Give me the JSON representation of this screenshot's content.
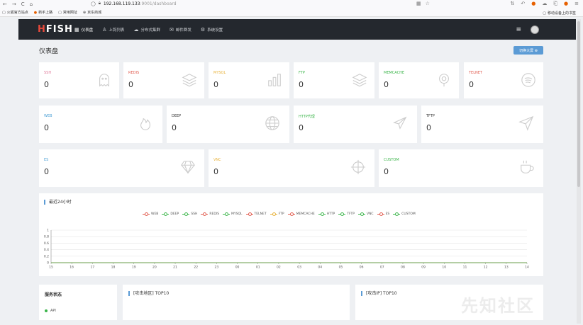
{
  "browser": {
    "host": "192.168.119.133",
    "path": ":9001/dashboard",
    "bookmarks": [
      "火狐官方站点",
      "新手上路",
      "常用网址",
      "京东商城"
    ],
    "mobile_bookmarks": "移动设备上的书签"
  },
  "app": {
    "logo_h": "H",
    "logo_rest": "FISH",
    "menu": [
      {
        "label": "仪表盘",
        "icon": "dashboard-icon",
        "active": true
      },
      {
        "label": "上钩列表",
        "icon": "user-icon",
        "active": false
      },
      {
        "label": "分布式集群",
        "icon": "cloud-icon",
        "active": false
      },
      {
        "label": "邮件群发",
        "icon": "mail-icon",
        "active": false
      },
      {
        "label": "系统设置",
        "icon": "gear-icon",
        "active": false
      }
    ]
  },
  "page": {
    "title": "仪表盘",
    "switch_button": "切换大屏 ⊕"
  },
  "cards": [
    {
      "label": "SSH",
      "value": "0",
      "color": "#e07a9a",
      "icon": "ghost-icon"
    },
    {
      "label": "REDIS",
      "value": "0",
      "color": "#e05a4d",
      "icon": "layers-icon"
    },
    {
      "label": "MYSQL",
      "value": "0",
      "color": "#e8b23a",
      "icon": "bar-chart-icon"
    },
    {
      "label": "FTP",
      "value": "0",
      "color": "#3bb54a",
      "icon": "layers-icon"
    },
    {
      "label": "MEMCACHE",
      "value": "0",
      "color": "#3bb54a",
      "icon": "pin-icon"
    },
    {
      "label": "TELNET",
      "value": "0",
      "color": "#e05a4d",
      "icon": "spotify-icon"
    },
    {
      "label": "WEB",
      "value": "0",
      "color": "#4a9fd5",
      "icon": "fire-icon"
    },
    {
      "label": "DEEP",
      "value": "0",
      "color": "#333333",
      "icon": "globe-icon"
    },
    {
      "label": "HTTP代理",
      "value": "0",
      "color": "#3bb54a",
      "icon": "plane-icon"
    },
    {
      "label": "TFTP",
      "value": "0",
      "color": "#333333",
      "icon": "send-icon"
    },
    {
      "label": "ES",
      "value": "0",
      "color": "#4a9fd5",
      "icon": "diamond-icon"
    },
    {
      "label": "VNC",
      "value": "0",
      "color": "#e8b23a",
      "icon": "crosshair-icon"
    },
    {
      "label": "CUSTOM",
      "value": "0",
      "color": "#3bb54a",
      "icon": "cup-icon"
    }
  ],
  "chart_data": {
    "type": "line",
    "title": "最近24小时",
    "categories": [
      "15",
      "16",
      "17",
      "18",
      "19",
      "20",
      "21",
      "22",
      "23",
      "00",
      "01",
      "02",
      "03",
      "04",
      "05",
      "06",
      "07",
      "08",
      "09",
      "10",
      "11",
      "12",
      "13",
      "14"
    ],
    "series": [
      {
        "name": "WEB",
        "color": "#e05a4d",
        "values": [
          0,
          0,
          0,
          0,
          0,
          0,
          0,
          0,
          0,
          0,
          0,
          0,
          0,
          0,
          0,
          0,
          0,
          0,
          0,
          0,
          0,
          0,
          0,
          0
        ]
      },
      {
        "name": "DEEP",
        "color": "#3bb54a",
        "values": [
          0,
          0,
          0,
          0,
          0,
          0,
          0,
          0,
          0,
          0,
          0,
          0,
          0,
          0,
          0,
          0,
          0,
          0,
          0,
          0,
          0,
          0,
          0,
          0
        ]
      },
      {
        "name": "SSH",
        "color": "#3bb54a",
        "values": [
          0,
          0,
          0,
          0,
          0,
          0,
          0,
          0,
          0,
          0,
          0,
          0,
          0,
          0,
          0,
          0,
          0,
          0,
          0,
          0,
          0,
          0,
          0,
          0
        ]
      },
      {
        "name": "REDIS",
        "color": "#e05a4d",
        "values": [
          0,
          0,
          0,
          0,
          0,
          0,
          0,
          0,
          0,
          0,
          0,
          0,
          0,
          0,
          0,
          0,
          0,
          0,
          0,
          0,
          0,
          0,
          0,
          0
        ]
      },
      {
        "name": "MYSQL",
        "color": "#3bb54a",
        "values": [
          0,
          0,
          0,
          0,
          0,
          0,
          0,
          0,
          0,
          0,
          0,
          0,
          0,
          0,
          0,
          0,
          0,
          0,
          0,
          0,
          0,
          0,
          0,
          0
        ]
      },
      {
        "name": "TELNET",
        "color": "#e05a4d",
        "values": [
          0,
          0,
          0,
          0,
          0,
          0,
          0,
          0,
          0,
          0,
          0,
          0,
          0,
          0,
          0,
          0,
          0,
          0,
          0,
          0,
          0,
          0,
          0,
          0
        ]
      },
      {
        "name": "FTP",
        "color": "#e8b23a",
        "values": [
          0,
          0,
          0,
          0,
          0,
          0,
          0,
          0,
          0,
          0,
          0,
          0,
          0,
          0,
          0,
          0,
          0,
          0,
          0,
          0,
          0,
          0,
          0,
          0
        ]
      },
      {
        "name": "MEMCACHE",
        "color": "#e05a4d",
        "values": [
          0,
          0,
          0,
          0,
          0,
          0,
          0,
          0,
          0,
          0,
          0,
          0,
          0,
          0,
          0,
          0,
          0,
          0,
          0,
          0,
          0,
          0,
          0,
          0
        ]
      },
      {
        "name": "HTTP",
        "color": "#3bb54a",
        "values": [
          0,
          0,
          0,
          0,
          0,
          0,
          0,
          0,
          0,
          0,
          0,
          0,
          0,
          0,
          0,
          0,
          0,
          0,
          0,
          0,
          0,
          0,
          0,
          0
        ]
      },
      {
        "name": "TFTP",
        "color": "#3bb54a",
        "values": [
          0,
          0,
          0,
          0,
          0,
          0,
          0,
          0,
          0,
          0,
          0,
          0,
          0,
          0,
          0,
          0,
          0,
          0,
          0,
          0,
          0,
          0,
          0,
          0
        ]
      },
      {
        "name": "VNC",
        "color": "#3bb54a",
        "values": [
          0,
          0,
          0,
          0,
          0,
          0,
          0,
          0,
          0,
          0,
          0,
          0,
          0,
          0,
          0,
          0,
          0,
          0,
          0,
          0,
          0,
          0,
          0,
          0
        ]
      },
      {
        "name": "ES",
        "color": "#e05a4d",
        "values": [
          0,
          0,
          0,
          0,
          0,
          0,
          0,
          0,
          0,
          0,
          0,
          0,
          0,
          0,
          0,
          0,
          0,
          0,
          0,
          0,
          0,
          0,
          0,
          0
        ]
      },
      {
        "name": "CUSTOM",
        "color": "#3bb54a",
        "values": [
          0,
          0,
          0,
          0,
          0,
          0,
          0,
          0,
          0,
          0,
          0,
          0,
          0,
          0,
          0,
          0,
          0,
          0,
          0,
          0,
          0,
          0,
          0,
          0
        ]
      }
    ],
    "y_ticks": [
      "0",
      "0.2",
      "0.4",
      "0.6",
      "0.8",
      "1"
    ],
    "ylim": [
      0,
      1
    ],
    "grid": true,
    "legend_position": "top-center"
  },
  "panels": {
    "service_status": "服务状态",
    "service_items": [
      {
        "label": "API",
        "status_color": "#3bb54a"
      }
    ],
    "attack_region": "[攻击地区] TOP10",
    "attack_ip": "[攻击IP] TOP10"
  },
  "watermark": "先知社区"
}
